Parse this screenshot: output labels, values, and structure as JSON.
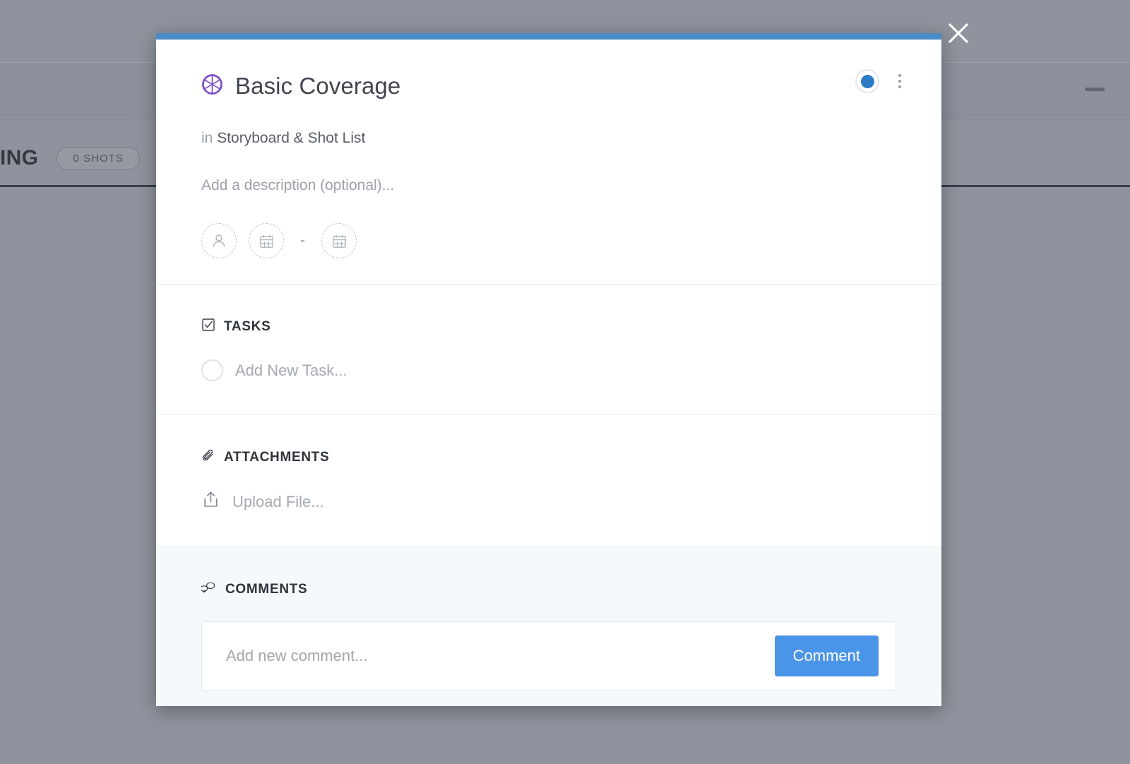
{
  "background": {
    "title": "ING",
    "shots_badge": "0 SHOTS",
    "minimize_icon": "minimize-icon"
  },
  "overlay": {
    "close_icon": "close-icon"
  },
  "modal": {
    "accent_color": "#4a8cc7",
    "card": {
      "aperture_icon": "aperture-icon",
      "title": "Basic Coverage",
      "board_prefix": "in",
      "board_name": "Storyboard & Shot List",
      "description_placeholder": "Add a description (optional)...",
      "status_indicator": {
        "icon": "status-dot-icon",
        "color": "#2b7cc4"
      },
      "more_menu_icon": "more-vertical-icon",
      "meta": {
        "member_icon": "person-icon",
        "start_date_icon": "calendar-icon",
        "date_separator": "-",
        "due_date_icon": "calendar-icon"
      }
    },
    "tasks": {
      "icon": "checkbox-checked-icon",
      "heading": "TASKS",
      "add_placeholder": "Add New Task..."
    },
    "attachments": {
      "icon": "paperclip-icon",
      "heading": "ATTACHMENTS",
      "upload_label": "Upload File...",
      "upload_icon": "upload-icon"
    },
    "comments": {
      "icon": "comments-icon",
      "heading": "COMMENTS",
      "input_placeholder": "Add new comment...",
      "input_value": "",
      "submit_label": "Comment",
      "submit_color": "#4a95e8"
    }
  }
}
